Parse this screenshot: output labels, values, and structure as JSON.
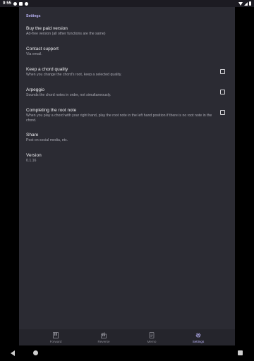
{
  "status_bar": {
    "time": "9:55",
    "left_icons": [
      "data-saver-icon",
      "notification-icon",
      "nfc-icon"
    ],
    "right_icons": [
      "wifi-icon",
      "signal-icon",
      "battery-icon"
    ]
  },
  "settings": {
    "section_title": "Settings",
    "items": [
      {
        "title": "Buy the paid version",
        "summary": "Ad-free version (all other functions are the same)",
        "has_checkbox": false
      },
      {
        "title": "Contact support",
        "summary": "Via email.",
        "has_checkbox": false
      },
      {
        "title": "Keep a chord quality",
        "summary": "When you change the chord's root, keep a selected quality.",
        "has_checkbox": true,
        "checked": false
      },
      {
        "title": "Arpeggio",
        "summary": "Sounds the chord notes in order, not simultaneously.",
        "has_checkbox": true,
        "checked": false
      },
      {
        "title": "Completing the root note",
        "summary": "When you play a chord with your right hand, play the root note in the left hand position if there is no root note in the chord.",
        "has_checkbox": true,
        "checked": false
      },
      {
        "title": "Share",
        "summary": "Post on social media, etc.",
        "has_checkbox": false
      },
      {
        "title": "Version",
        "summary": "0.1.16",
        "has_checkbox": false
      }
    ]
  },
  "bottom_nav": {
    "items": [
      {
        "label": "Forward",
        "icon": "piano-icon",
        "active": false
      },
      {
        "label": "Reverse",
        "icon": "reverse-piano-icon",
        "active": false
      },
      {
        "label": "Memo",
        "icon": "memo-icon",
        "active": false
      },
      {
        "label": "Settings",
        "icon": "gear-icon",
        "active": true
      }
    ]
  },
  "colors": {
    "background": "#2b2b33",
    "accent": "#b9b3f6",
    "text_primary": "#f0f0f3",
    "text_secondary": "#a9a9b2"
  }
}
